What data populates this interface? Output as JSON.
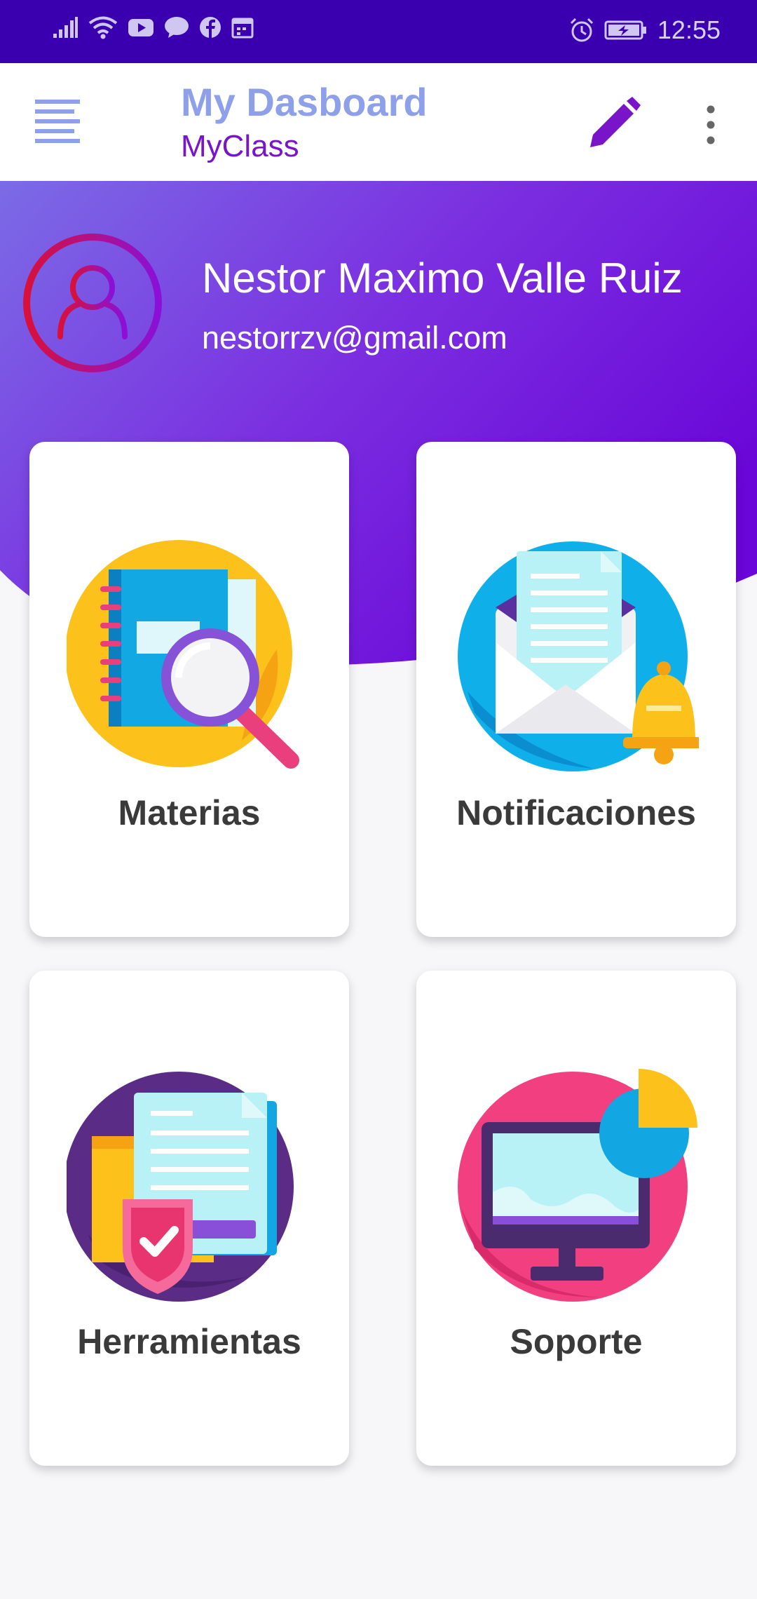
{
  "status_bar": {
    "time": "12:55",
    "left_icons": [
      "signal-icon",
      "wifi-icon",
      "youtube-icon",
      "messenger-icon",
      "facebook-icon",
      "calendar-icon"
    ],
    "right_icons": [
      "alarm-icon",
      "battery-charging-icon"
    ]
  },
  "toolbar": {
    "menu_icon": "menu-icon",
    "title": "My Dasboard",
    "subtitle": "MyClass",
    "edit_icon": "edit-icon",
    "more_icon": "more-vert-icon"
  },
  "profile": {
    "name": "Nestor Maximo Valle Ruiz",
    "email": "nestorrzv@gmail.com",
    "avatar_icon": "user-avatar-icon"
  },
  "cards": [
    {
      "label": "Materias",
      "icon": "books-search-icon"
    },
    {
      "label": "Notificaciones",
      "icon": "mail-bell-icon"
    },
    {
      "label": "Herramientas",
      "icon": "folder-shield-icon"
    },
    {
      "label": "Soporte",
      "icon": "monitor-chart-icon"
    }
  ],
  "colors": {
    "status_bar": "#3a00b0",
    "title": "#8ea0ea",
    "subtitle": "#7a14c8",
    "gradient_start": "#7b6be6",
    "gradient_end": "#6a06d8",
    "card_label": "#3a3a3a"
  }
}
